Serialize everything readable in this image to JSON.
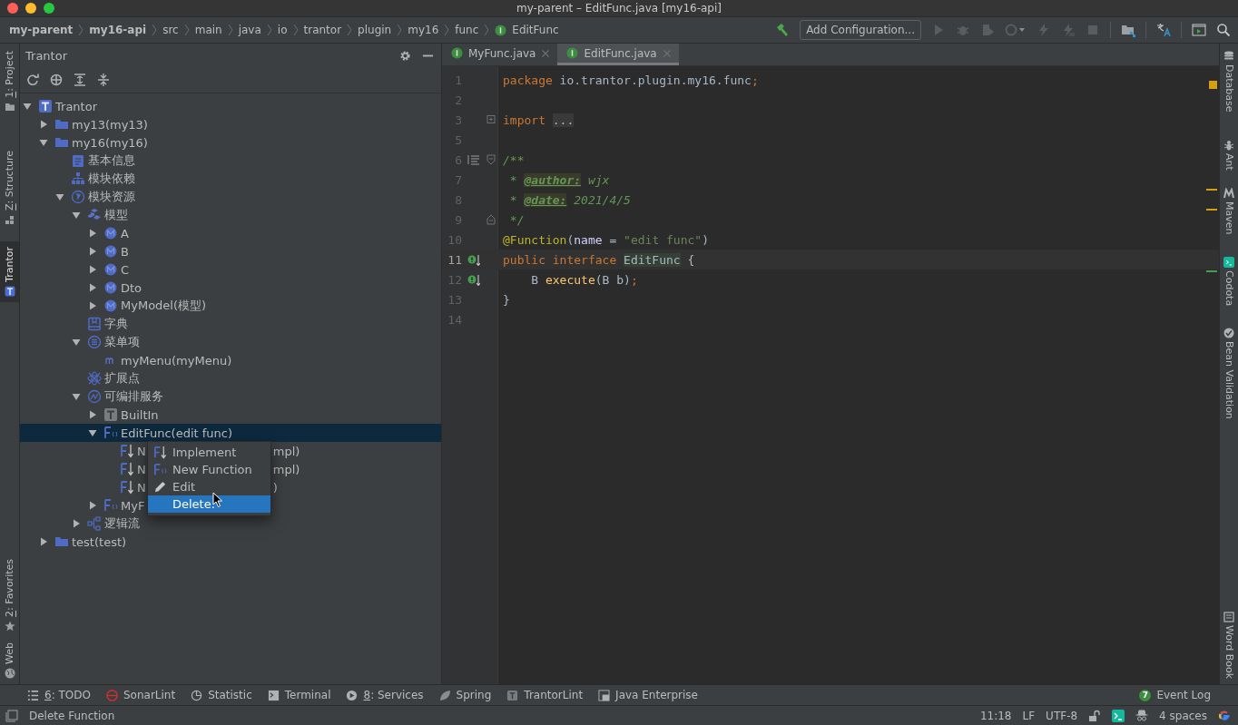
{
  "window": {
    "title": "my-parent – EditFunc.java [my16-api]"
  },
  "breadcrumbs": [
    {
      "label": "my-parent",
      "kind": "project"
    },
    {
      "label": "my16-api",
      "kind": "project"
    },
    {
      "label": "src",
      "kind": "dir"
    },
    {
      "label": "main",
      "kind": "dir"
    },
    {
      "label": "java",
      "kind": "dir"
    },
    {
      "label": "io",
      "kind": "dir"
    },
    {
      "label": "trantor",
      "kind": "dir"
    },
    {
      "label": "plugin",
      "kind": "dir"
    },
    {
      "label": "my16",
      "kind": "dir"
    },
    {
      "label": "func",
      "kind": "dir"
    },
    {
      "label": "EditFunc",
      "kind": "interface"
    }
  ],
  "run_config": {
    "label": "Add Configuration..."
  },
  "left_stripe": {
    "top": [
      {
        "key": "1",
        "label": ": Project",
        "selected": false
      },
      {
        "key": "Z",
        "label": ": Structure",
        "selected": false
      },
      {
        "label": "Trantor",
        "selected": true
      }
    ],
    "bottom": [
      {
        "key": "2",
        "label": ": Favorites",
        "selected": false
      },
      {
        "label": "Web",
        "selected": false
      }
    ]
  },
  "right_stripe": {
    "top": [
      {
        "label": "Database"
      },
      {
        "label": "Ant"
      },
      {
        "label": "Maven"
      },
      {
        "label": "Codota"
      },
      {
        "label": "Bean Validation"
      }
    ],
    "bottom": [
      {
        "label": "Word Book"
      }
    ]
  },
  "tool_window": {
    "title": "Trantor",
    "tree": [
      {
        "label": "Trantor",
        "kind": "root",
        "expanded": true,
        "selected": false,
        "children": [
          {
            "label": "my13(my13)",
            "kind": "module",
            "expanded": false,
            "selected": false
          },
          {
            "label": "my16(my16)",
            "kind": "module",
            "expanded": true,
            "selected": false,
            "children": [
              {
                "label": "基本信息",
                "kind": "info",
                "selected": false
              },
              {
                "label": "模块依赖",
                "kind": "dependencies",
                "selected": false
              },
              {
                "label": "模块资源",
                "kind": "resources",
                "expanded": true,
                "selected": false,
                "children": [
                  {
                    "label": "模型",
                    "kind": "models",
                    "expanded": true,
                    "selected": false,
                    "children": [
                      {
                        "label": "A",
                        "kind": "model",
                        "expanded": false,
                        "selected": false
                      },
                      {
                        "label": "B",
                        "kind": "model",
                        "expanded": false,
                        "selected": false
                      },
                      {
                        "label": "C",
                        "kind": "model",
                        "expanded": false,
                        "selected": false
                      },
                      {
                        "label": "Dto",
                        "kind": "model",
                        "expanded": false,
                        "selected": false
                      },
                      {
                        "label": "MyModel(模型)",
                        "kind": "model",
                        "expanded": false,
                        "selected": false
                      }
                    ]
                  },
                  {
                    "label": "字典",
                    "kind": "dictionary",
                    "selected": false
                  },
                  {
                    "label": "菜单项",
                    "kind": "menus",
                    "expanded": true,
                    "selected": false,
                    "children": [
                      {
                        "label": "myMenu(myMenu)",
                        "kind": "menu",
                        "selected": false
                      }
                    ]
                  },
                  {
                    "label": "扩展点",
                    "kind": "extensions",
                    "selected": false
                  },
                  {
                    "label": "可编排服务",
                    "kind": "services",
                    "expanded": true,
                    "selected": false,
                    "children": [
                      {
                        "label": "BuiltIn",
                        "kind": "builtin",
                        "expanded": false,
                        "selected": false
                      },
                      {
                        "label": "EditFunc(edit func)",
                        "kind": "function",
                        "expanded": true,
                        "selected": true,
                        "children": [
                          {
                            "label": "N",
                            "tail": "mpl)",
                            "kind": "implementation",
                            "selected": false
                          },
                          {
                            "label": "N",
                            "tail": "mpl)",
                            "kind": "implementation",
                            "selected": false
                          },
                          {
                            "label": "N",
                            "tail": ")",
                            "kind": "implementation",
                            "selected": false
                          }
                        ]
                      },
                      {
                        "label": "MyF",
                        "kind": "function",
                        "expanded": false,
                        "selected": false
                      }
                    ]
                  },
                  {
                    "label": "逻辑流",
                    "kind": "logic",
                    "expanded": false,
                    "selected": false
                  }
                ]
              }
            ]
          },
          {
            "label": "test(test)",
            "kind": "module",
            "expanded": false,
            "selected": false
          }
        ]
      }
    ]
  },
  "context_menu": [
    {
      "label": "Implement",
      "selected": false
    },
    {
      "label": "New Function",
      "selected": false
    },
    {
      "label": "Edit",
      "selected": false
    },
    {
      "label": "Delete.",
      "selected": true
    }
  ],
  "editor": {
    "tabs": [
      {
        "label": "MyFunc.java",
        "selected": false
      },
      {
        "label": "EditFunc.java",
        "selected": true
      }
    ],
    "lines": [
      {
        "number": "1",
        "current": false,
        "tokens": [
          {
            "kind": "keyword",
            "text": "package"
          },
          {
            "kind": "plain",
            "text": " io.trantor.plugin.my16.func"
          },
          {
            "kind": "keyword",
            "text": ";"
          }
        ]
      },
      {
        "number": "2",
        "current": false
      },
      {
        "number": "3",
        "current": false,
        "tokens": [
          {
            "kind": "keyword",
            "text": "import"
          },
          {
            "kind": "folded",
            "text": "..."
          }
        ]
      },
      {
        "number": "5",
        "current": false
      },
      {
        "number": "6",
        "current": false,
        "tokens": [
          {
            "kind": "comment",
            "text": "/**"
          }
        ]
      },
      {
        "number": "7",
        "current": false,
        "tokens": [
          {
            "kind": "comment",
            "text": " * "
          },
          {
            "kind": "doctag",
            "text": "@author:"
          },
          {
            "kind": "comment",
            "text": " wjx"
          }
        ]
      },
      {
        "number": "8",
        "current": false,
        "tokens": [
          {
            "kind": "comment",
            "text": " * "
          },
          {
            "kind": "doctag",
            "text": "@date:"
          },
          {
            "kind": "comment",
            "text": " 2021/4/5"
          }
        ]
      },
      {
        "number": "9",
        "current": false,
        "tokens": [
          {
            "kind": "comment",
            "text": " */"
          }
        ]
      },
      {
        "number": "10",
        "current": false,
        "tokens": [
          {
            "kind": "annotation",
            "text": "@Function"
          },
          {
            "kind": "plain",
            "text": "("
          },
          {
            "kind": "attr",
            "text": "name"
          },
          {
            "kind": "plain",
            "text": " = "
          },
          {
            "kind": "string",
            "text": "\"edit func\""
          },
          {
            "kind": "plain",
            "text": ")"
          }
        ]
      },
      {
        "number": "11",
        "current": true,
        "tokens": [
          {
            "kind": "keyword",
            "text": "public interface "
          },
          {
            "kind": "declared",
            "text": "EditFunc"
          },
          {
            "kind": "plain",
            "text": " {"
          }
        ]
      },
      {
        "number": "12",
        "current": false,
        "tokens": [
          {
            "kind": "plain",
            "text": "    B "
          },
          {
            "kind": "method",
            "text": "execute"
          },
          {
            "kind": "plain",
            "text": "(B b)"
          },
          {
            "kind": "keyword",
            "text": ";"
          }
        ]
      },
      {
        "number": "13",
        "current": false,
        "tokens": [
          {
            "kind": "plain",
            "text": "}"
          }
        ]
      },
      {
        "number": "14",
        "current": false
      }
    ]
  },
  "tool_buttons": [
    {
      "key": "6",
      "label": ": TODO"
    },
    {
      "label": "SonarLint"
    },
    {
      "label": "Statistic"
    },
    {
      "label": "Terminal"
    },
    {
      "key": "8",
      "label": ": Services"
    },
    {
      "label": "Spring"
    },
    {
      "label": "TrantorLint"
    },
    {
      "label": "Java Enterprise"
    }
  ],
  "event_log": {
    "label": "Event Log",
    "count": "7"
  },
  "status_bar": {
    "message": "Delete Function",
    "position": "11:18",
    "line_separator": "LF",
    "encoding": "UTF-8",
    "indent": "4 spaces"
  }
}
